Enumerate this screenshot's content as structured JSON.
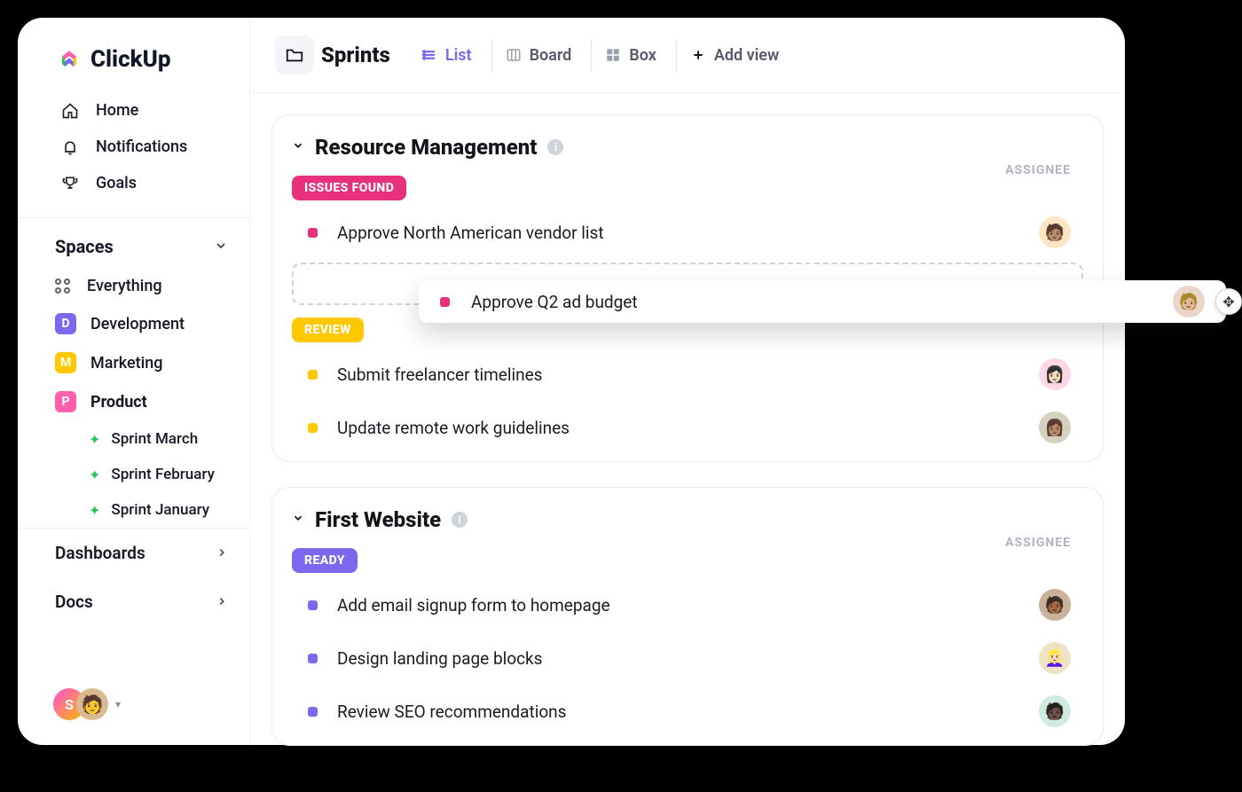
{
  "brand": {
    "name": "ClickUp"
  },
  "sidebar": {
    "nav": {
      "home": "Home",
      "notifications": "Notifications",
      "goals": "Goals"
    },
    "spaces_header": "Spaces",
    "everything": "Everything",
    "spaces": {
      "development": {
        "letter": "D",
        "label": "Development"
      },
      "marketing": {
        "letter": "M",
        "label": "Marketing"
      },
      "product": {
        "letter": "P",
        "label": "Product"
      }
    },
    "sprints": {
      "march": "Sprint  March",
      "february": "Sprint  February",
      "january": "Sprint January"
    },
    "dashboards": "Dashboards",
    "docs": "Docs",
    "user_initial": "S"
  },
  "topbar": {
    "folder_title": "Sprints",
    "views": {
      "list": "List",
      "board": "Board",
      "box": "Box",
      "add": "Add view"
    }
  },
  "sections": {
    "resource": {
      "title": "Resource Management",
      "assignee_label": "ASSIGNEE",
      "statuses": {
        "issues": "ISSUES FOUND",
        "review": "REVIEW"
      },
      "tasks": {
        "vendor": "Approve North American vendor list",
        "adbudget": "Approve Q2 ad budget",
        "freelancer": "Submit freelancer timelines",
        "remote": "Update remote work guidelines"
      }
    },
    "website": {
      "title": "First Website",
      "assignee_label": "ASSIGNEE",
      "statuses": {
        "ready": "READY"
      },
      "tasks": {
        "signup": "Add email signup form to homepage",
        "landing": "Design landing page blocks",
        "seo": "Review SEO recommendations"
      }
    }
  }
}
